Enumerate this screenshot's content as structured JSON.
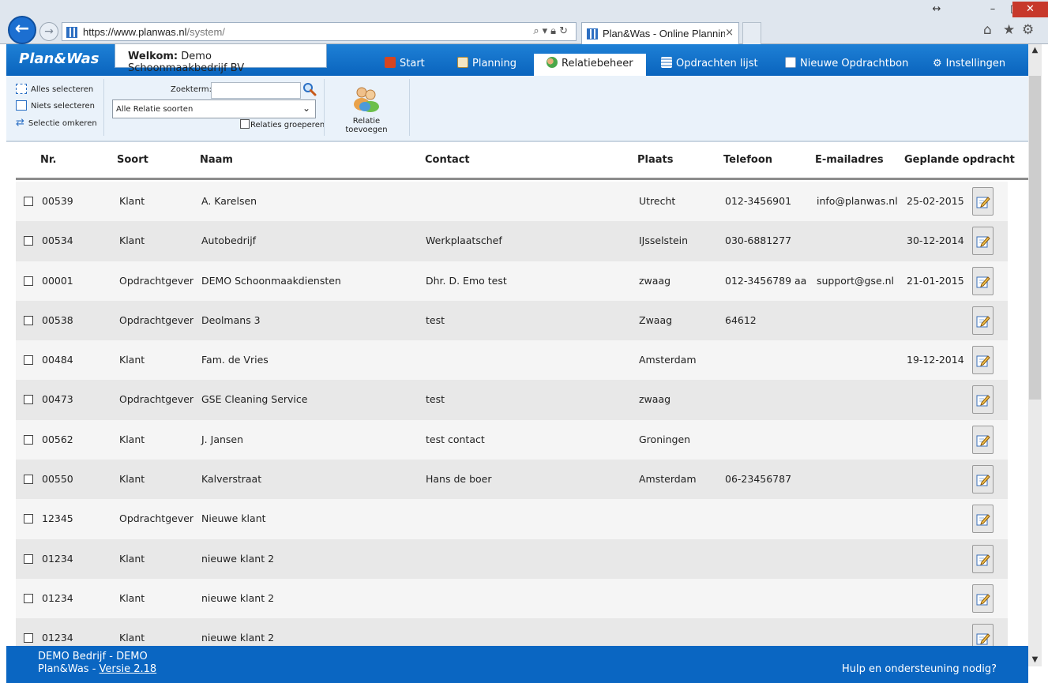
{
  "browser": {
    "url_main": "https://www.planwas.nl",
    "url_path": "/system/",
    "tab_title": "Plan&Was - Online Plannin...",
    "tab_close": "×",
    "win_restore": "↔",
    "win_minimize": "–",
    "win_maximize": "□",
    "win_close": "✕"
  },
  "app": {
    "logo": "Plan&Was",
    "welcome_label": "Welkom:",
    "welcome_name": "Demo Schoonmaakbedrijf BV",
    "nav": [
      {
        "label": "Start",
        "color": "#d64520"
      },
      {
        "label": "Planning",
        "color": "#e0a72c"
      },
      {
        "label": "Relatiebeheer",
        "color": "#4aa84a"
      },
      {
        "label": "Opdrachten lijst",
        "color": "#ffffff"
      },
      {
        "label": "Nieuwe Opdrachtbon",
        "color": "#ffffff"
      },
      {
        "label": "Instellingen",
        "color": "#ffffff"
      }
    ],
    "active_nav": "Relatiebeheer"
  },
  "toolbar": {
    "select_all": "Alles selecteren",
    "select_none": "Niets selecteren",
    "select_invert": "Selectie omkeren",
    "search_label": "Zoekterm:",
    "search_value": "",
    "relation_type": "Alle Relatie soorten",
    "group_label": "Relaties groeperen",
    "add_relation": "Relatie toevoegen"
  },
  "table": {
    "headers": [
      "Nr.",
      "Soort",
      "Naam",
      "Contact",
      "Plaats",
      "Telefoon",
      "E-mailadres",
      "Geplande opdracht"
    ],
    "rows": [
      {
        "nr": "00539",
        "soort": "Klant",
        "naam": "A. Karelsen",
        "contact": "",
        "plaats": "Utrecht",
        "telefoon": "012-3456901",
        "email": "info@planwas.nl",
        "gepland": "25-02-2015"
      },
      {
        "nr": "00534",
        "soort": "Klant",
        "naam": "Autobedrijf",
        "contact": "Werkplaatschef",
        "plaats": "IJsselstein",
        "telefoon": "030-6881277",
        "email": "",
        "gepland": "30-12-2014"
      },
      {
        "nr": "00001",
        "soort": "Opdrachtgever",
        "naam": "DEMO Schoonmaakdiensten",
        "contact": "Dhr. D. Emo test",
        "plaats": "zwaag",
        "telefoon": "012-3456789 aa",
        "email": "support@gse.nl",
        "gepland": "21-01-2015"
      },
      {
        "nr": "00538",
        "soort": "Opdrachtgever",
        "naam": "Deolmans 3",
        "contact": "test",
        "plaats": "Zwaag",
        "telefoon": "64612",
        "email": "",
        "gepland": ""
      },
      {
        "nr": "00484",
        "soort": "Klant",
        "naam": "Fam. de Vries",
        "contact": "",
        "plaats": "Amsterdam",
        "telefoon": "",
        "email": "",
        "gepland": "19-12-2014"
      },
      {
        "nr": "00473",
        "soort": "Opdrachtgever",
        "naam": "GSE Cleaning Service",
        "contact": "test",
        "plaats": "zwaag",
        "telefoon": "",
        "email": "",
        "gepland": ""
      },
      {
        "nr": "00562",
        "soort": "Klant",
        "naam": "J. Jansen",
        "contact": "test contact",
        "plaats": "Groningen",
        "telefoon": "",
        "email": "",
        "gepland": ""
      },
      {
        "nr": "00550",
        "soort": "Klant",
        "naam": "Kalverstraat",
        "contact": "Hans de boer",
        "plaats": "Amsterdam",
        "telefoon": "06-23456787",
        "email": "",
        "gepland": ""
      },
      {
        "nr": "12345",
        "soort": "Opdrachtgever",
        "naam": "Nieuwe klant",
        "contact": "",
        "plaats": "",
        "telefoon": "",
        "email": "",
        "gepland": ""
      },
      {
        "nr": "01234",
        "soort": "Klant",
        "naam": "nieuwe klant 2",
        "contact": "",
        "plaats": "",
        "telefoon": "",
        "email": "",
        "gepland": ""
      },
      {
        "nr": "01234",
        "soort": "Klant",
        "naam": "nieuwe klant 2",
        "contact": "",
        "plaats": "",
        "telefoon": "",
        "email": "",
        "gepland": ""
      },
      {
        "nr": "01234",
        "soort": "Klant",
        "naam": "nieuwe klant 2",
        "contact": "",
        "plaats": "",
        "telefoon": "",
        "email": "",
        "gepland": ""
      }
    ]
  },
  "footer": {
    "company": "DEMO Bedrijf - DEMO",
    "product": "Plan&Was - ",
    "version": "Versie 2.18",
    "help": "Hulp en ondersteuning nodig?"
  }
}
